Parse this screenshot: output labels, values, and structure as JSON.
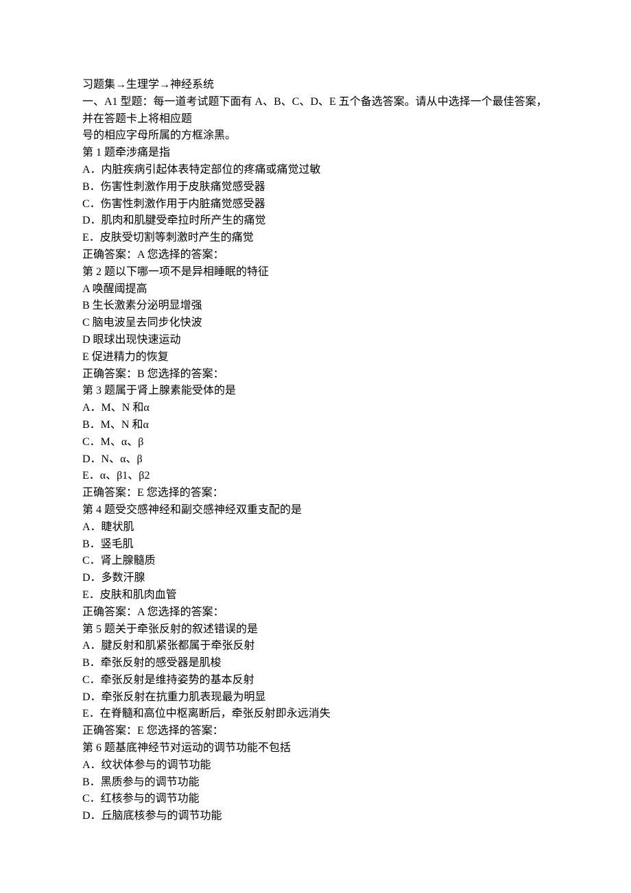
{
  "header": {
    "breadcrumb": "习题集→生理学→神经系统",
    "section_intro": "一、A1 型题：每一道考试题下面有 A、B、C、D、E 五个备选答案。请从中选择一个最佳答案，并在答题卡上将相应题",
    "section_intro_2": "号的相应字母所属的方框涂黑。"
  },
  "questions": [
    {
      "title": "第 1 题牵涉痛是指",
      "options": [
        "A．内脏疾病引起体表特定部位的疼痛或痛觉过敏",
        "B．伤害性刺激作用于皮肤痛觉感受器",
        "C．伤害性刺激作用于内脏痛觉感受器",
        "D．肌肉和肌腱受牵拉时所产生的痛觉",
        "E．皮肤受切割等刺激时产生的痛觉"
      ],
      "answer": "正确答案：A  您选择的答案："
    },
    {
      "title": "第 2 题以下哪一项不是异相睡眠的特征",
      "options": [
        "A  唤醒阈提高",
        "B  生长激素分泌明显增强",
        "C  脑电波呈去同步化快波",
        "D  眼球出现快速运动",
        "E  促进精力的恢复"
      ],
      "answer": "正确答案：B  您选择的答案："
    },
    {
      "title": "第 3 题属于肾上腺素能受体的是",
      "options": [
        "A．M、N 和α",
        "B．M、N 和α",
        "C．M、α、β",
        "D．N、α、β",
        "E．α、β1、β2"
      ],
      "answer": "正确答案：E  您选择的答案："
    },
    {
      "title": "第 4 题受交感神经和副交感神经双重支配的是",
      "options": [
        "A．睫状肌",
        "B．竖毛肌",
        "C．肾上腺髓质",
        "D．多数汗腺",
        "E．皮肤和肌肉血管"
      ],
      "answer": "正确答案：A  您选择的答案："
    },
    {
      "title": "第 5 题关于牵张反射的叙述错误的是",
      "options": [
        "A．腱反射和肌紧张都属于牵张反射",
        "B．牵张反射的感受器是肌梭",
        "C．牵张反射是维持姿势的基本反射",
        "D．牵张反射在抗重力肌表现最为明显",
        "E．在脊髓和高位中枢离断后，牵张反射即永远消失"
      ],
      "answer": "正确答案：E  您选择的答案："
    },
    {
      "title": "第 6 题基底神经节对运动的调节功能不包括",
      "options": [
        "A．纹状体参与的调节功能",
        "B．黑质参与的调节功能",
        "C．红核参与的调节功能",
        "D．丘脑底核参与的调节功能"
      ],
      "answer": ""
    }
  ]
}
